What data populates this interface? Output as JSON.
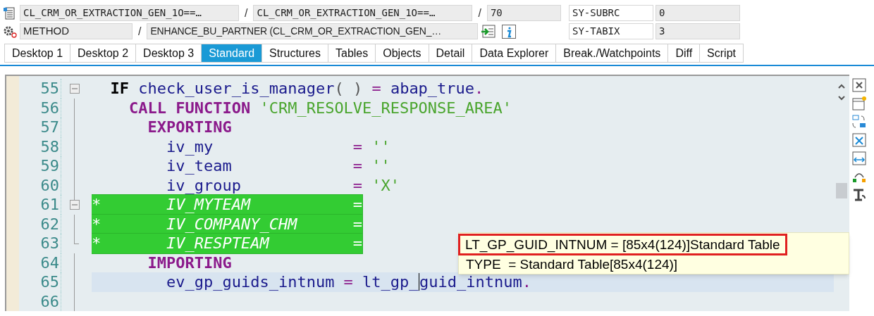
{
  "header": {
    "rows": [
      {
        "fields": [
          {
            "kind": "field",
            "value": "CL_CRM_OR_EXTRACTION_GEN_1O==…"
          },
          {
            "kind": "sep",
            "value": "/"
          },
          {
            "kind": "field",
            "value": "CL_CRM_OR_EXTRACTION_GEN_1O==…"
          },
          {
            "kind": "sep",
            "value": "/"
          },
          {
            "kind": "field",
            "value": "70"
          }
        ],
        "sys_label": "SY-SUBRC",
        "sys_value": "0"
      },
      {
        "fields": [
          {
            "kind": "field",
            "value": "METHOD"
          },
          {
            "kind": "sep",
            "value": "/"
          },
          {
            "kind": "field",
            "value": "ENHANCE_BU_PARTNER (CL_CRM_OR_EXTRACTION_GEN_…"
          },
          {
            "kind": "transfer"
          },
          {
            "kind": "info"
          }
        ],
        "sys_label": "SY-TABIX",
        "sys_value": "3"
      }
    ]
  },
  "tabs": [
    {
      "label": "Desktop 1",
      "selected": false
    },
    {
      "label": "Desktop 2",
      "selected": false
    },
    {
      "label": "Desktop 3",
      "selected": false
    },
    {
      "label": "Standard",
      "selected": true
    },
    {
      "label": "Structures",
      "selected": false
    },
    {
      "label": "Tables",
      "selected": false
    },
    {
      "label": "Objects",
      "selected": false
    },
    {
      "label": "Detail",
      "selected": false
    },
    {
      "label": "Data Explorer",
      "selected": false
    },
    {
      "label": "Break./Watchpoints",
      "selected": false
    },
    {
      "label": "Diff",
      "selected": false
    },
    {
      "label": "Script",
      "selected": false
    }
  ],
  "editor": {
    "lines": [
      {
        "number": "55",
        "kind": "toggle",
        "selected": false,
        "current": false,
        "tokens": [
          {
            "kind": "control",
            "text": "  IF"
          },
          {
            "kind": "ident",
            "text": " check_user_is_manager"
          },
          {
            "kind": "punct",
            "text": "( )"
          },
          {
            "kind": "op",
            "text": " ="
          },
          {
            "kind": "ident",
            "text": " abap_true"
          },
          {
            "kind": "op",
            "text": "."
          }
        ]
      },
      {
        "number": "56",
        "kind": "branch",
        "selected": false,
        "current": false,
        "tokens": [
          {
            "kind": "keyword",
            "text": "    CALL FUNCTION"
          },
          {
            "kind": "string",
            "text": " 'CRM_RESOLVE_RESPONSE_AREA'"
          }
        ]
      },
      {
        "number": "57",
        "kind": "branch",
        "selected": false,
        "current": false,
        "tokens": [
          {
            "kind": "keyword",
            "text": "      EXPORTING"
          }
        ]
      },
      {
        "number": "58",
        "kind": "branch",
        "selected": false,
        "current": false,
        "tokens": [
          {
            "kind": "ident",
            "text": "        iv_my"
          },
          {
            "kind": "op",
            "text": "               ="
          },
          {
            "kind": "string",
            "text": " ''"
          }
        ]
      },
      {
        "number": "59",
        "kind": "branch",
        "selected": false,
        "current": false,
        "tokens": [
          {
            "kind": "ident",
            "text": "        iv_team"
          },
          {
            "kind": "op",
            "text": "             ="
          },
          {
            "kind": "string",
            "text": " ''"
          }
        ]
      },
      {
        "number": "60",
        "kind": "branch",
        "selected": false,
        "current": false,
        "tokens": [
          {
            "kind": "ident",
            "text": "        iv_group"
          },
          {
            "kind": "op",
            "text": "            ="
          },
          {
            "kind": "string",
            "text": " 'X'"
          }
        ]
      },
      {
        "number": "61",
        "kind": "toggle",
        "selected": true,
        "current": false,
        "tokens": [
          {
            "kind": "comment",
            "text": "*       IV_MYTEAM           ="
          }
        ]
      },
      {
        "number": "62",
        "kind": "branch",
        "selected": true,
        "current": false,
        "tokens": [
          {
            "kind": "comment",
            "text": "*       IV_COMPANY_CHM      ="
          }
        ]
      },
      {
        "number": "63",
        "kind": "end",
        "selected": true,
        "current": false,
        "tokens": [
          {
            "kind": "comment",
            "text": "*       IV_RESPTEAM         ="
          }
        ]
      },
      {
        "number": "64",
        "kind": "branch",
        "selected": false,
        "current": false,
        "tokens": [
          {
            "kind": "keyword",
            "text": "      IMPORTING"
          }
        ]
      },
      {
        "number": "65",
        "kind": "branch",
        "selected": false,
        "current": true,
        "tokens": [
          {
            "kind": "ident",
            "text": "        ev_gp_guids_intnum"
          },
          {
            "kind": "op",
            "text": " ="
          },
          {
            "kind": "ident",
            "text": " lt_gp_"
          },
          {
            "kind": "ident",
            "text": "guid_intnum",
            "caret": true
          },
          {
            "kind": "op",
            "text": "."
          }
        ]
      },
      {
        "number": "66",
        "kind": "branch"
      }
    ]
  },
  "tooltip": {
    "lines": [
      {
        "text": "LT_GP_GUID_INTNUM = [85x4(124)]Standard Table",
        "boxed": true
      },
      {
        "text": "TYPE  = Standard Table[85x4(124)]",
        "boxed": false
      }
    ]
  }
}
